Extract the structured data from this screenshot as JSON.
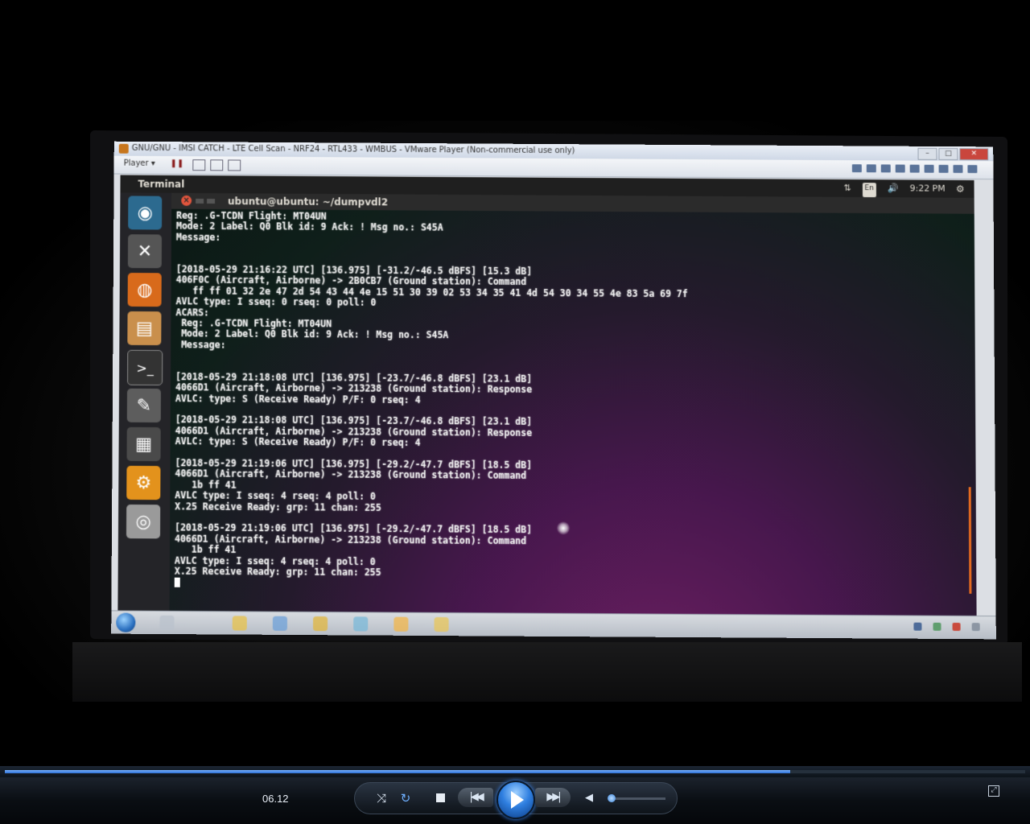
{
  "vmware": {
    "window_title": "GNU/GNU - IMSI CATCH - LTE Cell Scan - NRF24 - RTL433 - WMBUS - VMware Player (Non-commercial use only)",
    "player_menu": "Player ▾"
  },
  "ubuntu": {
    "app_name": "Terminal",
    "keyboard_layout": "En",
    "clock": "9:22 PM",
    "launcher": [
      "dash-icon",
      "settings-icon",
      "firefox-icon",
      "files-icon",
      "terminal-icon",
      "text-editor-icon",
      "calculator-icon",
      "gears-icon",
      "disc-icon"
    ]
  },
  "terminal": {
    "title": "ubuntu@ubuntu: ~/dumpvdl2",
    "lines": [
      "Reg: .G-TCDN Flight: MT04UN",
      "Mode: 2 Label: Q0 Blk id: 9 Ack: ! Msg no.: S45A",
      "Message:",
      "",
      "",
      "[2018-05-29 21:16:22 UTC] [136.975] [-31.2/-46.5 dBFS] [15.3 dB]",
      "406F0C (Aircraft, Airborne) -> 2B0CB7 (Ground station): Command",
      "   ff ff 01 32 2e 47 2d 54 43 44 4e 15 51 30 39 02 53 34 35 41 4d 54 30 34 55 4e 83 5a 69 7f",
      "AVLC type: I sseq: 0 rseq: 0 poll: 0",
      "ACARS:",
      " Reg: .G-TCDN Flight: MT04UN",
      " Mode: 2 Label: Q0 Blk id: 9 Ack: ! Msg no.: S45A",
      " Message:",
      "",
      "",
      "[2018-05-29 21:18:08 UTC] [136.975] [-23.7/-46.8 dBFS] [23.1 dB]",
      "4066D1 (Aircraft, Airborne) -> 213238 (Ground station): Response",
      "AVLC: type: S (Receive Ready) P/F: 0 rseq: 4",
      "",
      "[2018-05-29 21:18:08 UTC] [136.975] [-23.7/-46.8 dBFS] [23.1 dB]",
      "4066D1 (Aircraft, Airborne) -> 213238 (Ground station): Response",
      "AVLC: type: S (Receive Ready) P/F: 0 rseq: 4",
      "",
      "[2018-05-29 21:19:06 UTC] [136.975] [-29.2/-47.7 dBFS] [18.5 dB]",
      "4066D1 (Aircraft, Airborne) -> 213238 (Ground station): Command",
      "   1b ff 41",
      "AVLC type: I sseq: 4 rseq: 4 poll: 0",
      "X.25 Receive Ready: grp: 11 chan: 255",
      "",
      "[2018-05-29 21:19:06 UTC] [136.975] [-29.2/-47.7 dBFS] [18.5 dB]",
      "4066D1 (Aircraft, Airborne) -> 213238 (Ground station): Command",
      "   1b ff 41",
      "AVLC type: I sseq: 4 rseq: 4 poll: 0",
      "X.25 Receive Ready: grp: 11 chan: 255"
    ]
  },
  "media_player": {
    "elapsed_time": "06.12",
    "seek_progress_fraction": 0.77,
    "volume_fraction": 0.0,
    "accent_color": "#3b8cff"
  }
}
